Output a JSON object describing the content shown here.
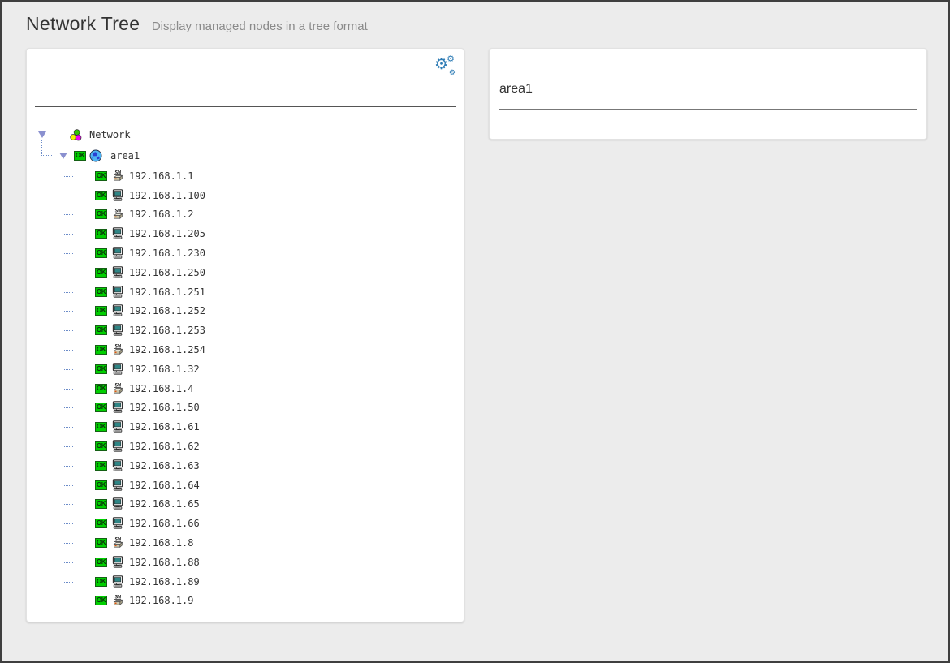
{
  "header": {
    "title": "Network Tree",
    "subtitle": "Display managed nodes in a tree format"
  },
  "icons": {
    "gears_glyph": "⚙"
  },
  "colors": {
    "accent_blue": "#2e7cb5",
    "ok_green": "#00cf00",
    "expander_triangle": "#8a90cf",
    "tree_connector": "#6b8bc8",
    "page_background": "#ececec",
    "separator_dark": "#555555"
  },
  "tree_panel": {
    "root": {
      "label": "Network",
      "expanded": true
    },
    "area": {
      "label": "area1",
      "status": "OK",
      "expanded": true
    },
    "nodes": [
      {
        "label": "192.168.1.1",
        "status": "OK",
        "icon": "switch"
      },
      {
        "label": "192.168.1.100",
        "status": "OK",
        "icon": "computer"
      },
      {
        "label": "192.168.1.2",
        "status": "OK",
        "icon": "switch"
      },
      {
        "label": "192.168.1.205",
        "status": "OK",
        "icon": "computer"
      },
      {
        "label": "192.168.1.230",
        "status": "OK",
        "icon": "computer"
      },
      {
        "label": "192.168.1.250",
        "status": "OK",
        "icon": "computer"
      },
      {
        "label": "192.168.1.251",
        "status": "OK",
        "icon": "computer"
      },
      {
        "label": "192.168.1.252",
        "status": "OK",
        "icon": "computer"
      },
      {
        "label": "192.168.1.253",
        "status": "OK",
        "icon": "computer"
      },
      {
        "label": "192.168.1.254",
        "status": "OK",
        "icon": "switch"
      },
      {
        "label": "192.168.1.32",
        "status": "OK",
        "icon": "computer"
      },
      {
        "label": "192.168.1.4",
        "status": "OK",
        "icon": "switch"
      },
      {
        "label": "192.168.1.50",
        "status": "OK",
        "icon": "computer"
      },
      {
        "label": "192.168.1.61",
        "status": "OK",
        "icon": "computer"
      },
      {
        "label": "192.168.1.62",
        "status": "OK",
        "icon": "computer"
      },
      {
        "label": "192.168.1.63",
        "status": "OK",
        "icon": "computer"
      },
      {
        "label": "192.168.1.64",
        "status": "OK",
        "icon": "computer"
      },
      {
        "label": "192.168.1.65",
        "status": "OK",
        "icon": "computer"
      },
      {
        "label": "192.168.1.66",
        "status": "OK",
        "icon": "computer"
      },
      {
        "label": "192.168.1.8",
        "status": "OK",
        "icon": "switch"
      },
      {
        "label": "192.168.1.88",
        "status": "OK",
        "icon": "computer"
      },
      {
        "label": "192.168.1.89",
        "status": "OK",
        "icon": "computer"
      },
      {
        "label": "192.168.1.9",
        "status": "OK",
        "icon": "switch"
      }
    ]
  },
  "detail_panel": {
    "title": "area1"
  }
}
